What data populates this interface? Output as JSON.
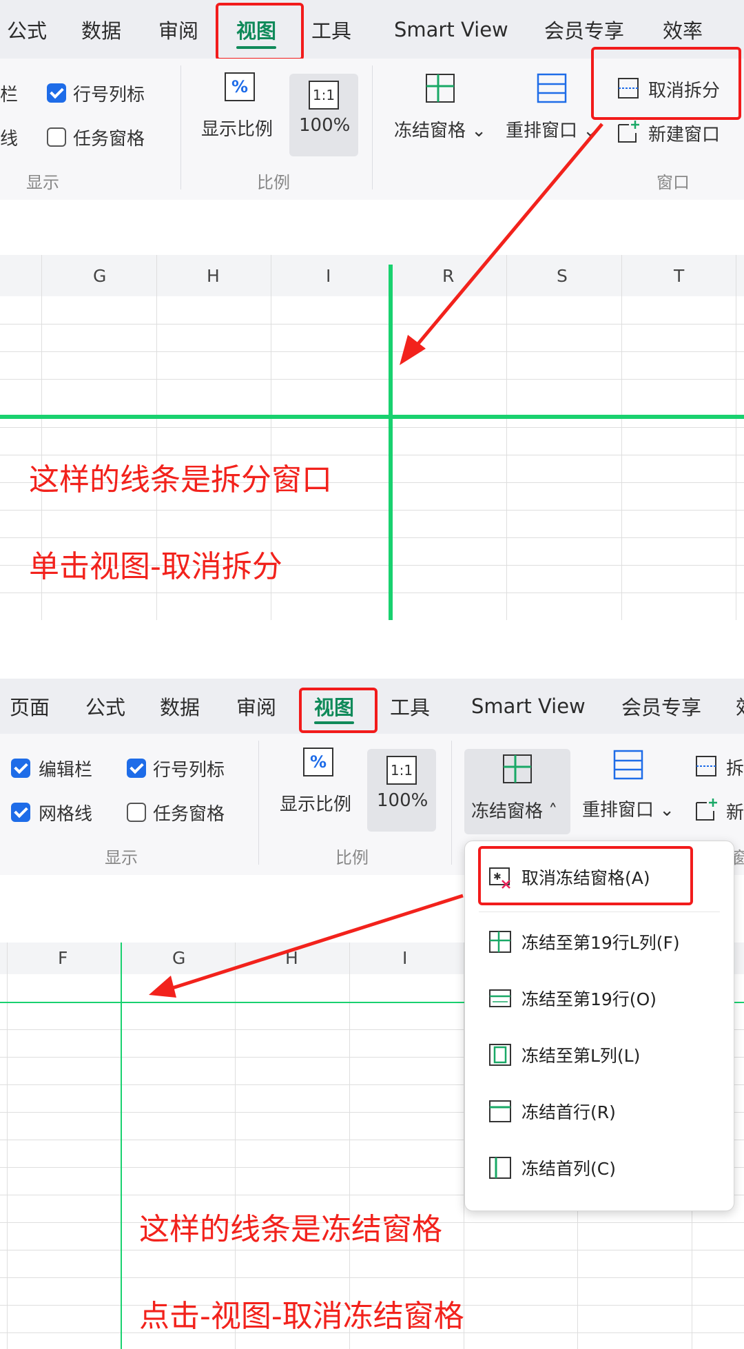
{
  "panel1": {
    "tabs": [
      "公式",
      "数据",
      "审阅",
      "视图",
      "工具",
      "Smart View",
      "会员专享",
      "效率"
    ],
    "active_tab": "视图",
    "display_group": {
      "cut_left_top": "栏",
      "cut_left_bottom": "线",
      "checkbox_rowcol": "行号列标",
      "checkbox_taskpane": "任务窗格",
      "label": "显示"
    },
    "ratio_group": {
      "zoom_label": "显示比例",
      "zoom100_icon": "1:1",
      "zoom100_label": "100%",
      "label": "比例"
    },
    "window_group": {
      "freeze_label": "冻结窗格",
      "rearrange_label": "重排窗口",
      "cancel_split": "取消拆分",
      "new_window": "新建窗口",
      "label": "窗口"
    },
    "columns": [
      "G",
      "H",
      "I",
      "R",
      "S",
      "T"
    ],
    "annotation_line1": "这样的线条是拆分窗口",
    "annotation_line2": "单击视图-取消拆分"
  },
  "panel2": {
    "tabs": [
      "页面",
      "公式",
      "数据",
      "审阅",
      "视图",
      "工具",
      "Smart View",
      "会员专享",
      "效"
    ],
    "active_tab": "视图",
    "display_group": {
      "checkbox_editbar": "编辑栏",
      "checkbox_rowcol": "行号列标",
      "checkbox_grid": "网格线",
      "checkbox_taskpane": "任务窗格",
      "label": "显示"
    },
    "ratio_group": {
      "zoom_label": "显示比例",
      "zoom100_icon": "1:1",
      "zoom100_label": "100%",
      "label": "比例"
    },
    "window_group": {
      "freeze_label": "冻结窗格",
      "rearrange_label": "重排窗口",
      "cut_split": "拆",
      "cut_new": "新",
      "cut_group": "窗"
    },
    "columns": [
      "F",
      "G",
      "H",
      "I"
    ],
    "freeze_menu": [
      "取消冻结窗格(A)",
      "冻结至第19行L列(F)",
      "冻结至第19行(O)",
      "冻结至第L列(L)",
      "冻结首行(R)",
      "冻结首列(C)"
    ],
    "annotation_line1": "这样的线条是冻结窗格",
    "annotation_line2": "点击-视图-取消冻结窗格"
  },
  "colors": {
    "accent_green": "#108a5a",
    "split_line_green": "#19d16f",
    "annotation_red": "#f2221c",
    "checkbox_blue": "#1e6ce8"
  }
}
